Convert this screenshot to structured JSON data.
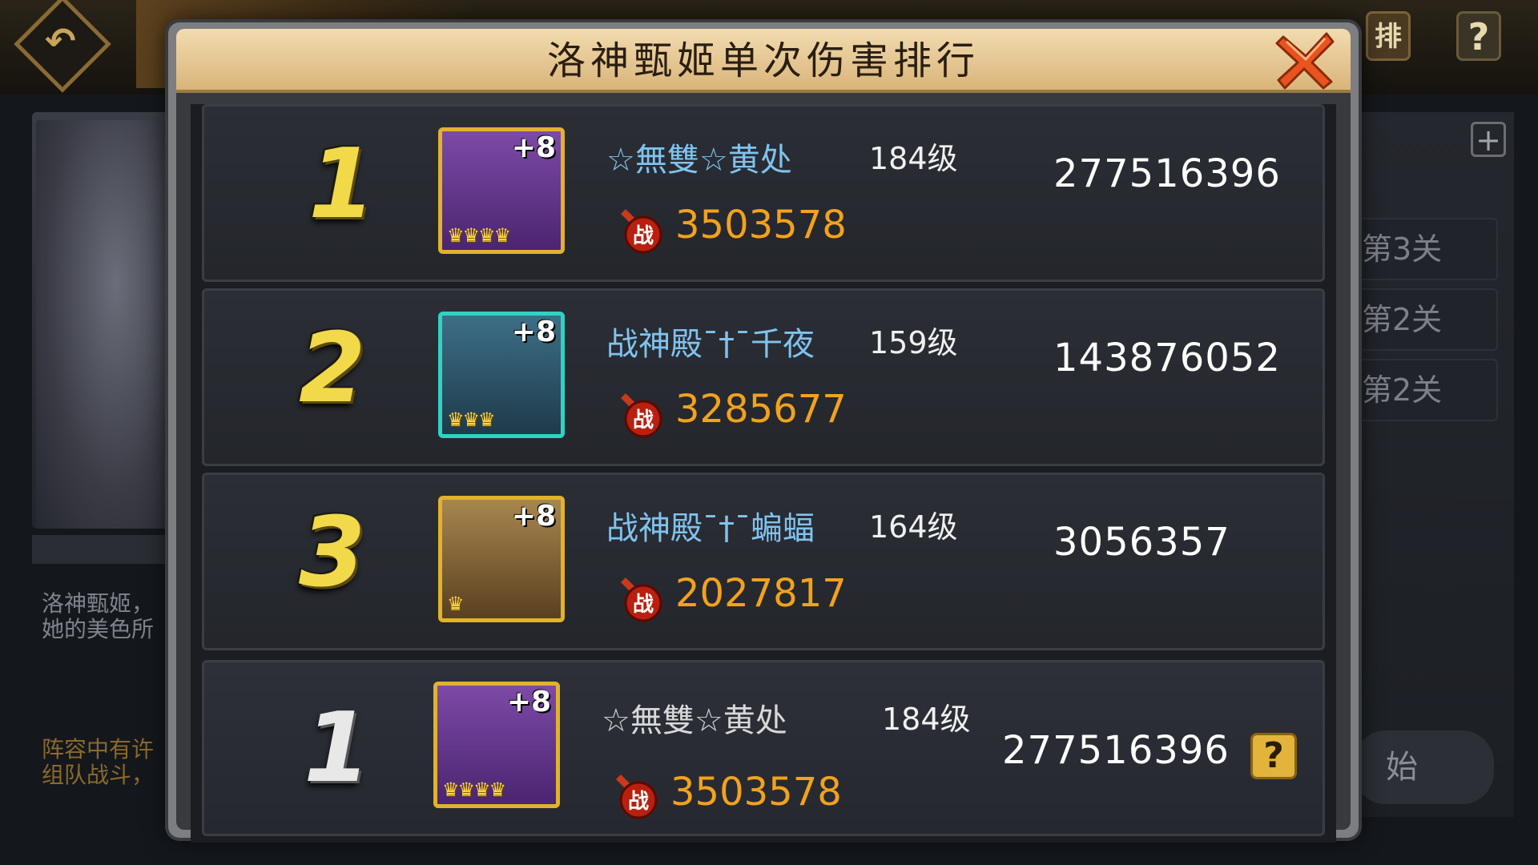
{
  "background": {
    "left_desc": "洛神甄姬，\n她的美色所",
    "left_team": "阵容中有许\n组队战斗，",
    "stages": [
      "第3关",
      "第2关",
      "第2关"
    ],
    "start_label": "始",
    "rank_button": "排",
    "help_button": "?",
    "plus_button": "+"
  },
  "modal": {
    "title": "洛神甄姬单次伤害排行",
    "close_icon": "close-x-icon"
  },
  "rows": [
    {
      "rank": "1",
      "name": "☆無雙☆黄处",
      "level": "184级",
      "power": "3503578",
      "damage": "277516396",
      "plus": "+8",
      "crowns": "♛♛♛♛",
      "frame": "gold",
      "portrait_color": "#6b3f92"
    },
    {
      "rank": "2",
      "name": "战神殿ˉ†ˉ千夜",
      "level": "159级",
      "power": "3285677",
      "damage": "143876052",
      "plus": "+8",
      "crowns": "♛♛♛",
      "frame": "cyan",
      "portrait_color": "#2f5a6e"
    },
    {
      "rank": "3",
      "name": "战神殿ˉ†ˉ蝙蝠",
      "level": "164级",
      "power": "2027817",
      "damage": "3056357",
      "plus": "+8",
      "crowns": "♛",
      "frame": "gold",
      "portrait_color": "#8a6a3a"
    }
  ],
  "my_row": {
    "rank": "1",
    "name": "☆無雙☆黄处",
    "level": "184级",
    "power": "3503578",
    "damage": "277516396",
    "plus": "+8",
    "crowns": "♛♛♛♛",
    "help": "?"
  },
  "colors": {
    "name_blue": "#7fc3ef",
    "power_orange": "#f2a21b",
    "rank_gold": "#f1d94a",
    "header_tan": "#e6c58f"
  }
}
